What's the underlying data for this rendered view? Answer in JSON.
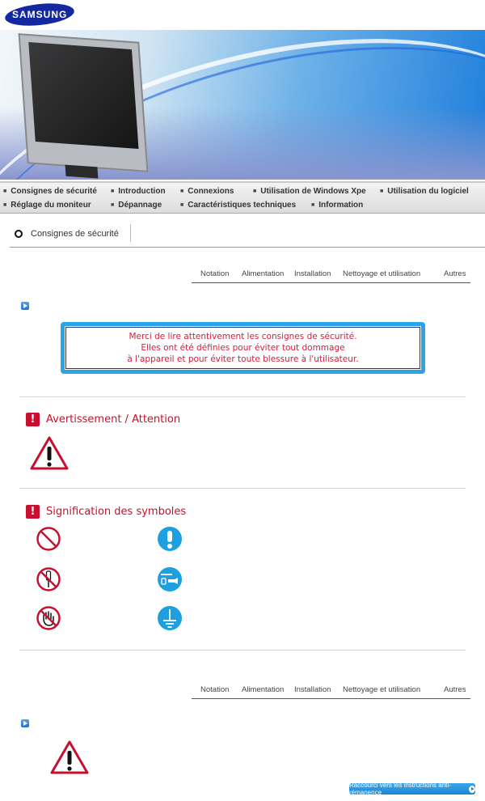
{
  "brand": {
    "logo_text": "SAMSUNG"
  },
  "nav": {
    "row1": [
      "Consignes de sécurité",
      "Introduction",
      "Connexions",
      "Utilisation de Windows Xpe",
      "Utilisation du logiciel"
    ],
    "row2": [
      "Réglage du moniteur",
      "Dépannage",
      "Caractéristiques techniques",
      "Information"
    ]
  },
  "section": {
    "title": "Consignes de sécurité"
  },
  "tabs": [
    "Notation",
    "Alimentation",
    "Installation",
    "Nettoyage et utilisation",
    "Autres"
  ],
  "notice": {
    "lines": [
      "Merci de lire attentivement les consignes de sécurité.",
      "Elles ont été définies pour éviter tout dommage",
      "à l'appareil et pour éviter toute blessure à l'utilisateur."
    ]
  },
  "headings": {
    "warning": "Avertissement / Attention",
    "symbols": "Signification des symboles"
  },
  "symbols": [
    "prohibited-icon",
    "important-icon",
    "no-disassembly-icon",
    "unplug-icon",
    "no-touch-icon",
    "ground-icon"
  ],
  "shortcut": {
    "label": "Raccourci vers les instructions anti-rémanence"
  },
  "colors": {
    "accent_red": "#c8102e",
    "accent_blue": "#2ba3e8",
    "brand_blue": "#1428a0"
  }
}
